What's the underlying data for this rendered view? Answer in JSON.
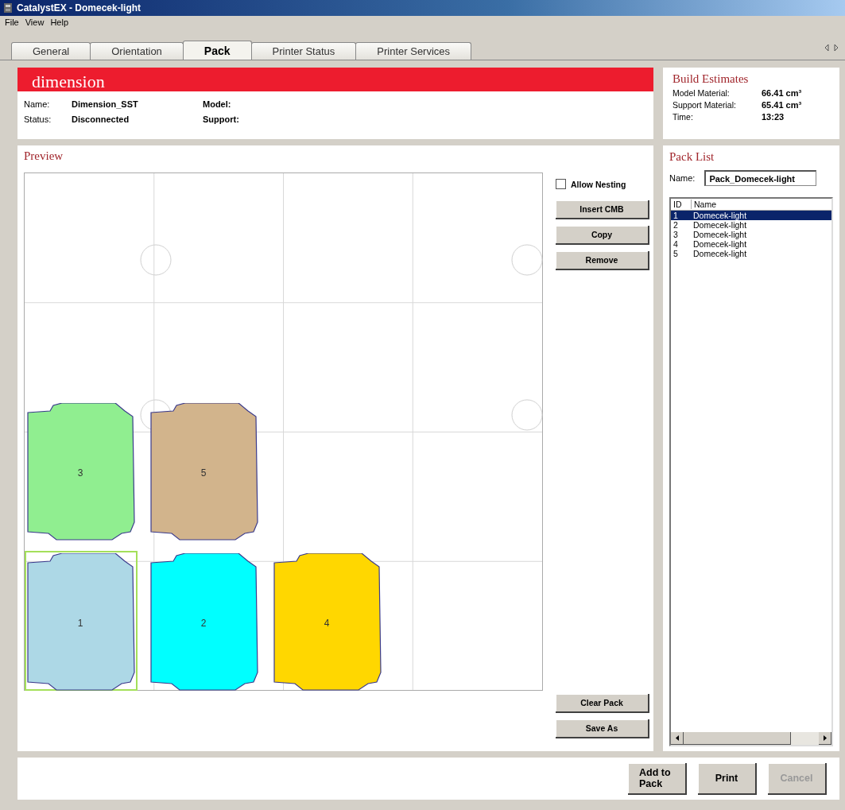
{
  "window": {
    "title": "CatalystEX - Domecek-light"
  },
  "menu": [
    "File",
    "View",
    "Help"
  ],
  "tabs": [
    {
      "label": "General",
      "selected": false
    },
    {
      "label": "Orientation",
      "selected": false
    },
    {
      "label": "Pack",
      "selected": true
    },
    {
      "label": "Printer Status",
      "selected": false
    },
    {
      "label": "Printer Services",
      "selected": false
    }
  ],
  "printer": {
    "logo": "dimension",
    "fields": [
      {
        "label": "Name:",
        "value": "Dimension_SST"
      },
      {
        "label": "Model:"
      },
      {
        "label": "Status:",
        "value": "Disconnected"
      },
      {
        "label": "Support:"
      }
    ]
  },
  "build_estimates": {
    "title": "Build Estimates",
    "rows": [
      {
        "label": "Model Material:",
        "value": "66.41 cm³"
      },
      {
        "label": "Support Material:",
        "value": "65.41 cm³"
      },
      {
        "label": "Time:",
        "value": "13:23"
      }
    ]
  },
  "preview": {
    "title": "Preview",
    "parts": [
      {
        "label": "3",
        "color": "#90ee90",
        "selected": false
      },
      {
        "label": "5",
        "color": "#d2b48c",
        "selected": false
      },
      {
        "label": "1",
        "color": "#add8e6",
        "selected": true
      },
      {
        "label": "2",
        "color": "#00ffff",
        "selected": false
      },
      {
        "label": "4",
        "color": "#ffd700",
        "selected": false
      }
    ],
    "allow_nesting": {
      "label": "Allow Nesting",
      "checked": false
    },
    "top_buttons": [
      "Insert CMB",
      "Copy",
      "Remove"
    ],
    "bottom_buttons": [
      "Clear Pack",
      "Save As"
    ]
  },
  "pack_list": {
    "title": "Pack List",
    "name_label": "Name:",
    "name_value": "Pack_Domecek-light",
    "columns": [
      "ID",
      "Name"
    ],
    "rows": [
      {
        "id": "1",
        "name": "Domecek-light",
        "selected": true
      },
      {
        "id": "2",
        "name": "Domecek-light",
        "selected": false
      },
      {
        "id": "3",
        "name": "Domecek-light",
        "selected": false
      },
      {
        "id": "4",
        "name": "Domecek-light",
        "selected": false
      },
      {
        "id": "5",
        "name": "Domecek-light",
        "selected": false
      }
    ]
  },
  "actions": [
    {
      "label": "Add to Pack",
      "disabled": false
    },
    {
      "label": "Print",
      "disabled": false
    },
    {
      "label": "Cancel",
      "disabled": true
    }
  ]
}
